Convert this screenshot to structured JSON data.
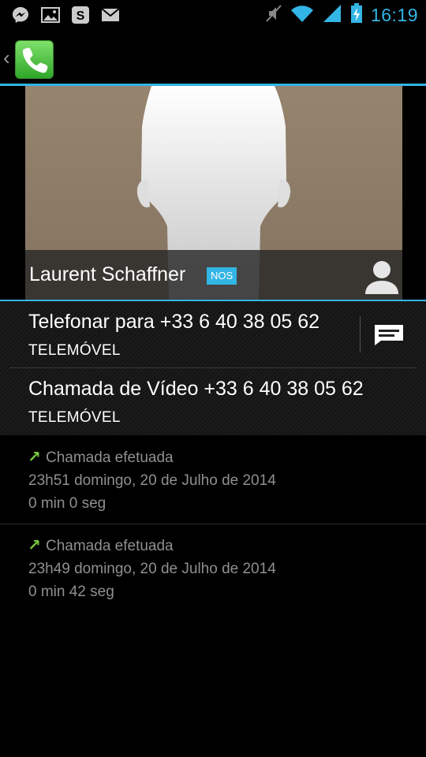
{
  "status_bar": {
    "time": "16:19",
    "icons_left": [
      "messenger-icon",
      "image-icon",
      "skype-icon",
      "gmail-icon"
    ],
    "icons_right": [
      "mute-icon",
      "wifi-icon",
      "signal-icon",
      "battery-charging-icon"
    ]
  },
  "action_bar": {
    "app_icon": "phone-app-icon"
  },
  "contact": {
    "name": "Laurent Schaffner",
    "network_badge": "NOS"
  },
  "actions": [
    {
      "label": "Telefonar para +33 6 40 38 05 62",
      "type": "TELEMÓVEL"
    },
    {
      "label": "Chamada de Vídeo +33 6 40 38 05 62",
      "type": "TELEMÓVEL"
    }
  ],
  "call_log": [
    {
      "arrow": "↗",
      "type": "Chamada efetuada",
      "date": "23h51 domingo, 20 de Julho de 2014",
      "duration": "0 min 0 seg"
    },
    {
      "arrow": "↗",
      "type": "Chamada efetuada",
      "date": "23h49 domingo, 20 de Julho de 2014",
      "duration": "0 min 42 seg"
    }
  ],
  "colors": {
    "accent": "#33b5e5",
    "outgoing_arrow": "#77c83a",
    "secondary_text": "#8f8f8f"
  }
}
